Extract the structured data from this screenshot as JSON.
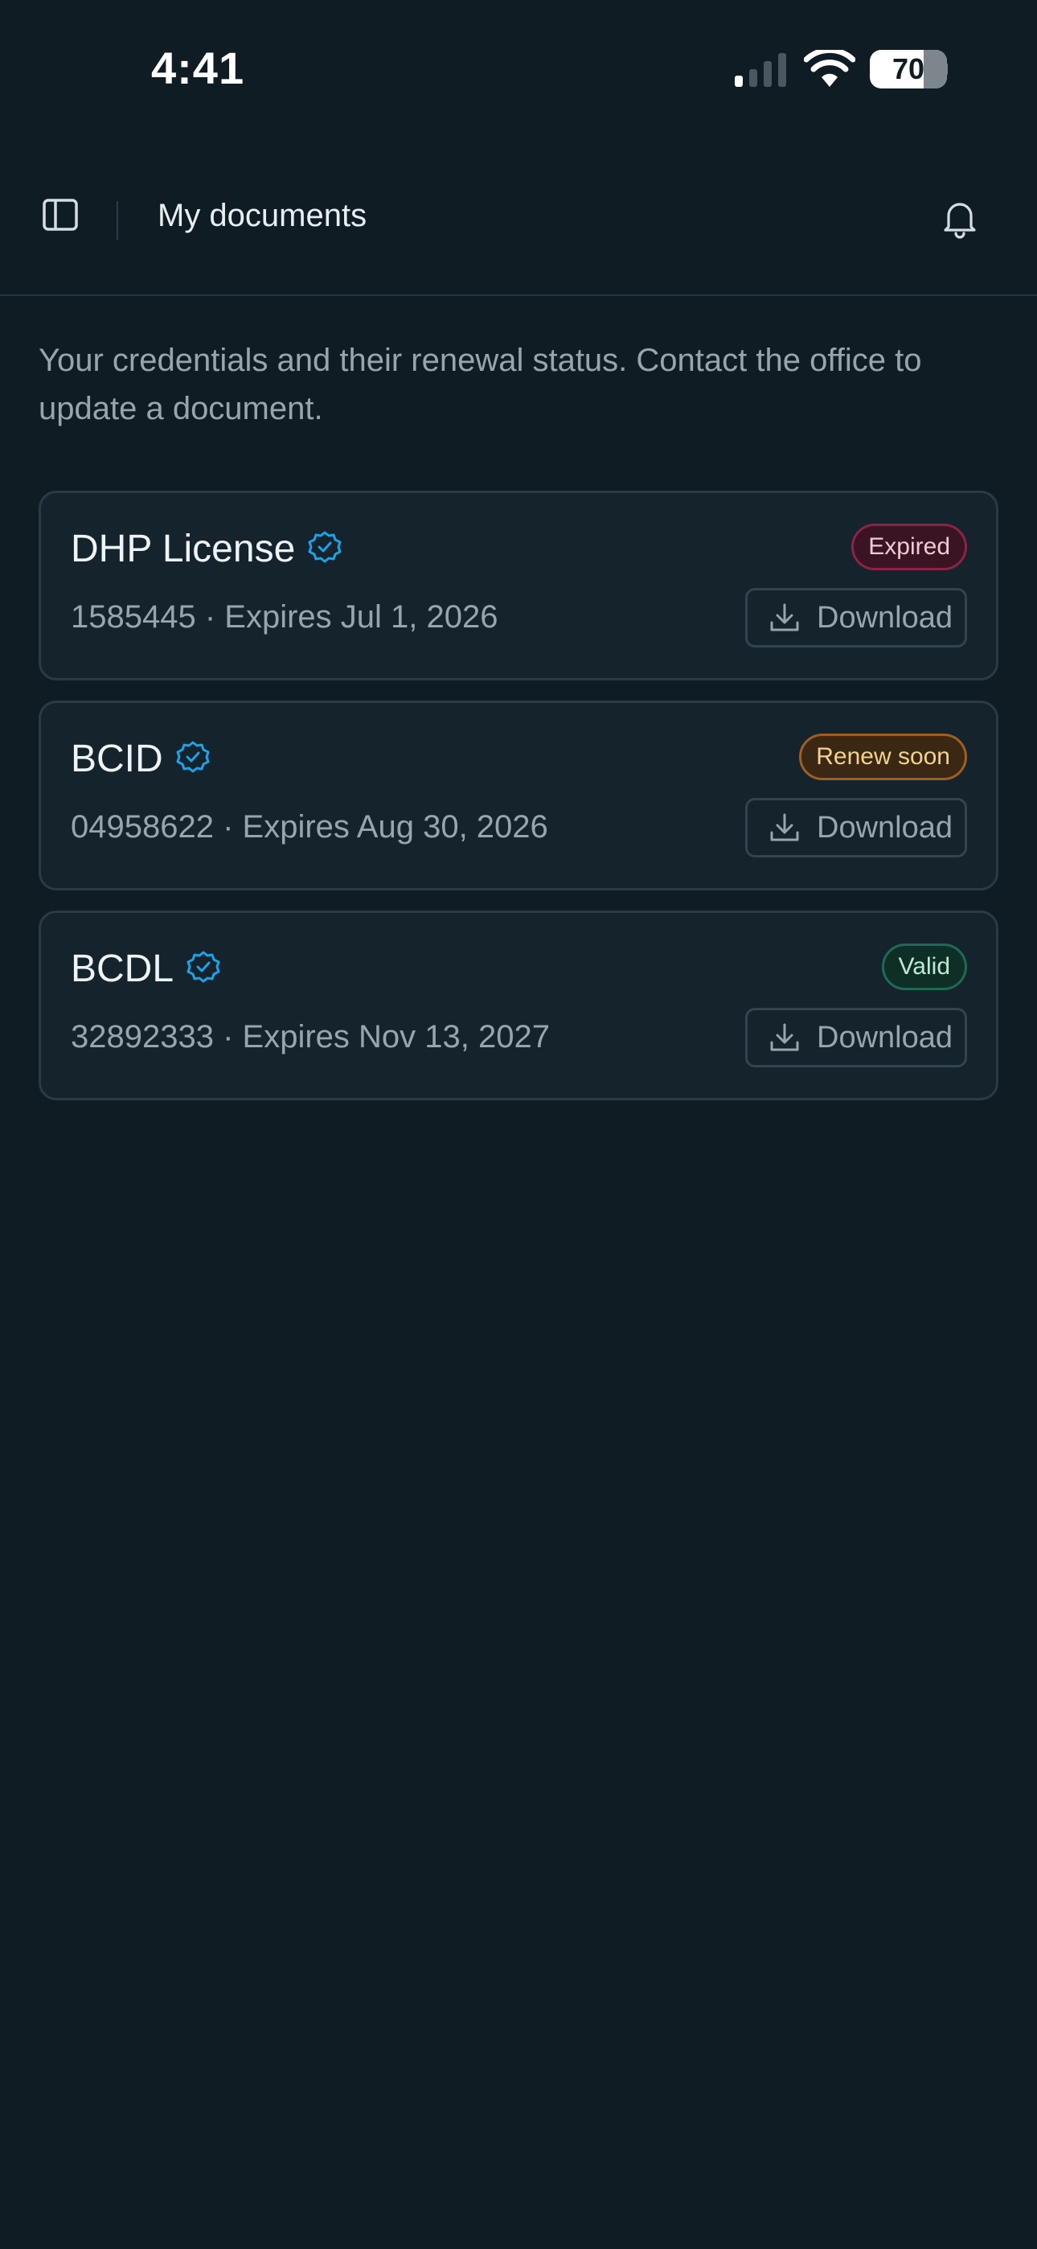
{
  "status_bar": {
    "time": "4:41",
    "battery": "70"
  },
  "header": {
    "title": "My documents"
  },
  "intro": "Your credentials and their renewal status. Contact the office to update a document.",
  "documents": [
    {
      "name": "DHP License",
      "meta": "1585445 · Expires Jul 1, 2026",
      "status": "Expired",
      "action": "Download"
    },
    {
      "name": "BCID",
      "meta": "04958622 · Expires Aug 30, 2026",
      "status": "Renew soon",
      "action": "Download"
    },
    {
      "name": "BCDL",
      "meta": "32892333 · Expires Nov 13, 2027",
      "status": "Valid",
      "action": "Download"
    }
  ],
  "colors": {
    "background": "#0f1c24",
    "card": "#15232c",
    "verified": "#1aa3e8",
    "expired": "#8c2246",
    "renew_soon": "#a05e22",
    "valid": "#1f6a52"
  },
  "icons": [
    "signal-icon",
    "wifi-icon",
    "battery-icon",
    "sidebar-toggle-icon",
    "bell-icon",
    "verified-badge-icon",
    "download-icon"
  ]
}
